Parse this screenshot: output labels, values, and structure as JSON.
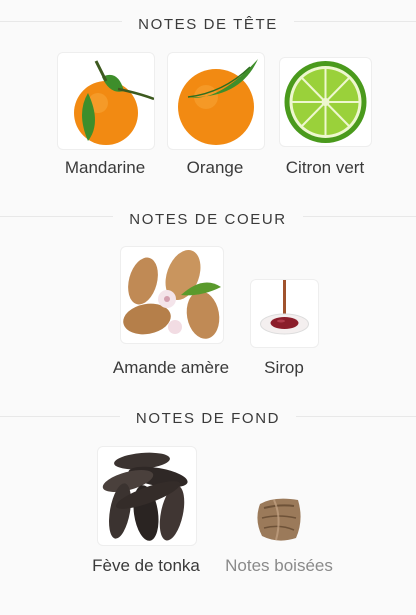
{
  "sections": [
    {
      "title": "NOTES DE TÊTE",
      "notes": [
        {
          "label": "Mandarine",
          "icon": "mandarin-icon"
        },
        {
          "label": "Orange",
          "icon": "orange-icon"
        },
        {
          "label": "Citron vert",
          "icon": "lime-icon"
        }
      ]
    },
    {
      "title": "NOTES DE COEUR",
      "notes": [
        {
          "label": "Amande amère",
          "icon": "almond-icon"
        },
        {
          "label": "Sirop",
          "icon": "syrup-icon"
        }
      ]
    },
    {
      "title": "NOTES DE FOND",
      "notes": [
        {
          "label": "Fève de tonka",
          "icon": "tonka-bean-icon"
        },
        {
          "label": "Notes boisées",
          "icon": "wood-icon"
        }
      ]
    }
  ],
  "colors": {
    "orange": "#f28a12",
    "lime": "#7cc226",
    "leaf": "#3e8e2b",
    "almond": "#c08a55",
    "syrup": "#8b1d2a",
    "tonka": "#3b3330",
    "wood": "#9b7a5a"
  }
}
